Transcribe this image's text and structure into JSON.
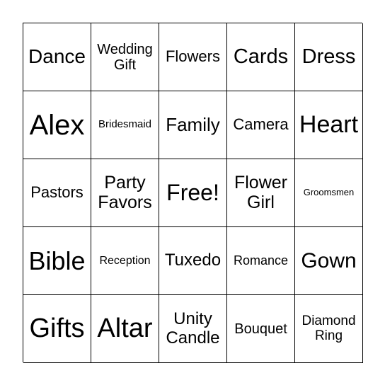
{
  "cells": [
    {
      "text": "Dance",
      "size": 28
    },
    {
      "text": "Wedding Gift",
      "size": 20
    },
    {
      "text": "Flowers",
      "size": 22
    },
    {
      "text": "Cards",
      "size": 29
    },
    {
      "text": "Dress",
      "size": 29
    },
    {
      "text": "Alex",
      "size": 40
    },
    {
      "text": "Bridesmaid",
      "size": 15
    },
    {
      "text": "Family",
      "size": 26
    },
    {
      "text": "Camera",
      "size": 22
    },
    {
      "text": "Heart",
      "size": 34
    },
    {
      "text": "Pastors",
      "size": 22
    },
    {
      "text": "Party Favors",
      "size": 25
    },
    {
      "text": "Free!",
      "size": 32
    },
    {
      "text": "Flower Girl",
      "size": 25
    },
    {
      "text": "Groomsmen",
      "size": 13
    },
    {
      "text": "Bible",
      "size": 36
    },
    {
      "text": "Reception",
      "size": 16
    },
    {
      "text": "Tuxedo",
      "size": 24
    },
    {
      "text": "Romance",
      "size": 18
    },
    {
      "text": "Gown",
      "size": 30
    },
    {
      "text": "Gifts",
      "size": 38
    },
    {
      "text": "Altar",
      "size": 38
    },
    {
      "text": "Unity Candle",
      "size": 24
    },
    {
      "text": "Bouquet",
      "size": 20
    },
    {
      "text": "Diamond Ring",
      "size": 19
    }
  ]
}
